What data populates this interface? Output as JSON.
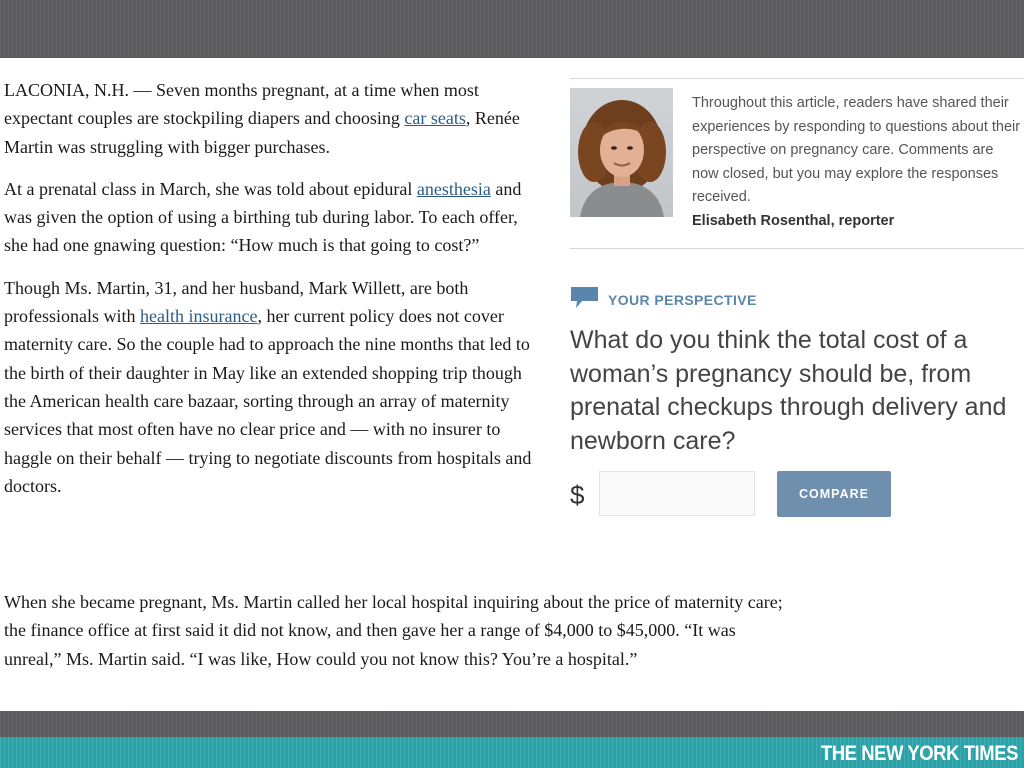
{
  "article": {
    "p1_text_a": "LACONIA, N.H. — Seven months pregnant, at a time when most expectant couples are stockpiling diapers and choosing ",
    "p1_link": "car seats",
    "p1_text_b": ", Renée Martin was struggling with bigger purchases.",
    "p2_text_a": "At a prenatal class in March, she was told about epidural ",
    "p2_link": "anesthesia",
    "p2_text_b": " and was given the option of using a birthing tub during labor. To each offer, she had one gnawing question: “How much is that going to cost?”",
    "p3_text_a": "Though Ms. Martin, 31, and her husband, Mark Willett, are both professionals with ",
    "p3_link": "health insurance",
    "p3_text_b": ", her current policy does not cover maternity care. So the couple had to approach the nine months that led to the birth of their daughter in May like an extended shopping trip though the American health care bazaar, sorting through an array of maternity services that most often have no clear price and — with no insurer to haggle on their behalf — trying to negotiate discounts from hospitals and doctors.",
    "p4_text": "When she became pregnant, Ms. Martin called her local hospital inquiring about the price of maternity care; the finance office at first said it did not know, and then gave her a range of $4,000 to $45,000. “It was unreal,” Ms. Martin said. “I was like, How could you not know this? You’re a hospital.”"
  },
  "sidebar": {
    "note": "Throughout this article, readers have shared their experiences by responding to questions about their perspective on pregnancy care. Comments are now closed, but you may explore the responses received.",
    "credit": "Elisabeth Rosenthal, reporter"
  },
  "perspective": {
    "icon": "speech-bubble-icon",
    "label": "YOUR PERSPECTIVE",
    "question": "What do you think the total cost of a woman’s pregnancy should be, from prenatal checkups through delivery and newborn care?",
    "currency": "$",
    "input_value": "",
    "button_label": "COMPARE"
  },
  "footer": {
    "brand": "THE NEW YORK TIMES"
  },
  "colors": {
    "accent_blue": "#5a86ad",
    "button_blue": "#6e8fae",
    "link_blue": "#2a5c8a",
    "footer_teal": "#2aa3a8",
    "band_gray": "#5b5b5d"
  }
}
